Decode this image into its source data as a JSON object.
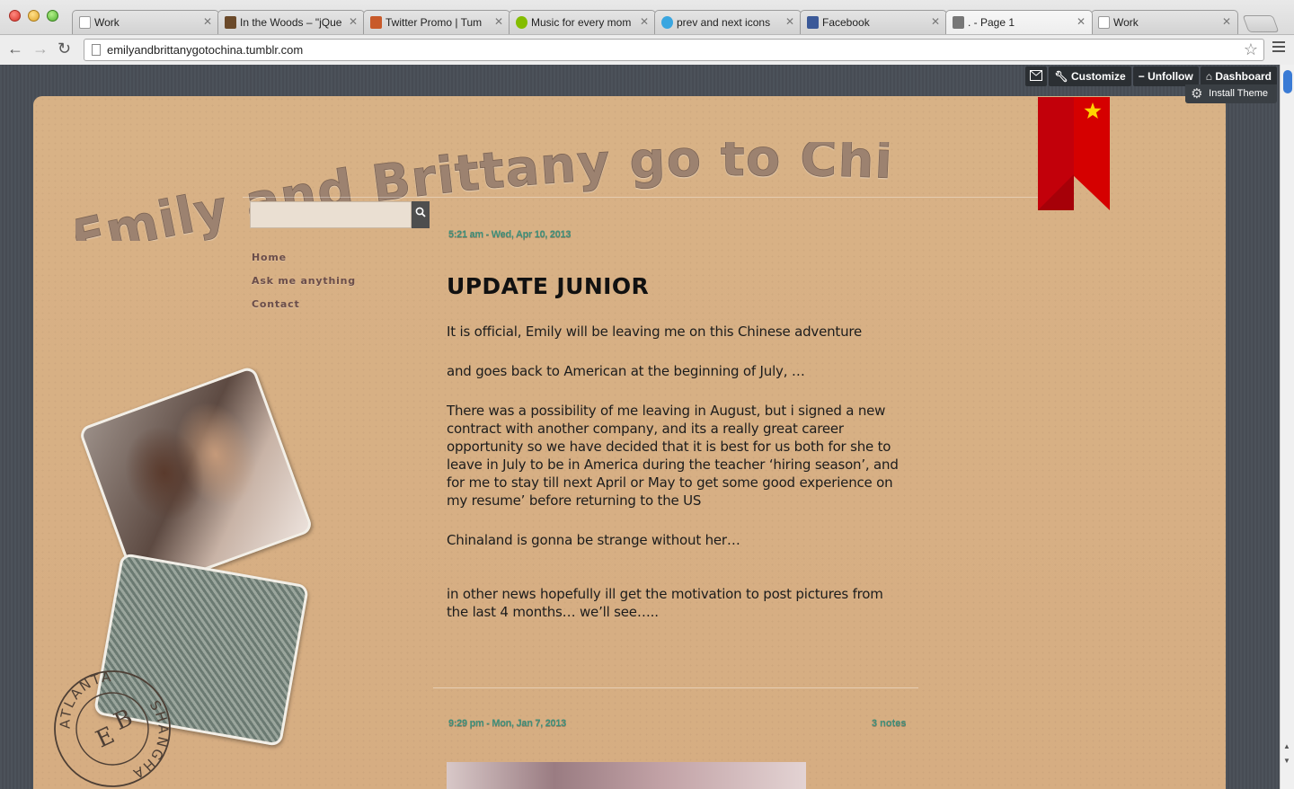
{
  "browser": {
    "tabs": [
      {
        "title": "Work",
        "favicon_color": "#ffffff",
        "active": false
      },
      {
        "title": "In the Woods – \"jQue",
        "favicon_color": "#6b4a2a",
        "active": false
      },
      {
        "title": "Twitter Promo | Tum",
        "favicon_color": "#c85a2a",
        "active": false
      },
      {
        "title": "Music for every mom",
        "favicon_color": "#84bd00",
        "active": false
      },
      {
        "title": "prev and next icons",
        "favicon_color": "#3aa6e0",
        "active": false
      },
      {
        "title": "Facebook",
        "favicon_color": "#3b5998",
        "active": false
      },
      {
        "title": ". - Page 1",
        "favicon_color": "#777777",
        "active": true
      },
      {
        "title": "Work",
        "favicon_color": "#ffffff",
        "active": false
      }
    ],
    "url": "emilyandbrittanygotochina.tumblr.com"
  },
  "tumblr_controls": {
    "customize": "Customize",
    "unfollow": "Unfollow",
    "dashboard": "Dashboard",
    "install_theme": "Install Theme"
  },
  "blog": {
    "title": "Emily and Brittany go to China",
    "nav": [
      "Home",
      "Ask me anything",
      "Contact"
    ],
    "stamp": {
      "top": "ATLANTA",
      "right": "SHANGHAI",
      "initials_1": "E",
      "initials_2": "B"
    }
  },
  "posts": [
    {
      "date": "5:21 am - Wed, Apr 10, 2013",
      "title": "UPDATE JUNIOR",
      "paragraphs": [
        "It is official, Emily will be leaving me on this Chinese adventure",
        "and goes back to American at the beginning of July, …",
        "There was a possibility of me leaving in August, but i signed a new contract with another company, and its a really great career opportunity so we have decided that it is best for us both for she to leave in July to be in America during the teacher ‘hiring season’, and for me to stay till next April or May to get some good experience on my resume’ before returning to the US",
        "Chinaland is gonna be strange without her…",
        "in other news hopefully ill get the motivation to post pictures from the last 4 months… we’ll see….."
      ]
    },
    {
      "date": "9:29 pm - Mon, Jan 7, 2013",
      "notes": "3 notes"
    }
  ],
  "colors": {
    "paper": "#d9b288",
    "date_text": "#3f8f7a",
    "ribbon": "#d50000",
    "star": "#ffd400"
  }
}
